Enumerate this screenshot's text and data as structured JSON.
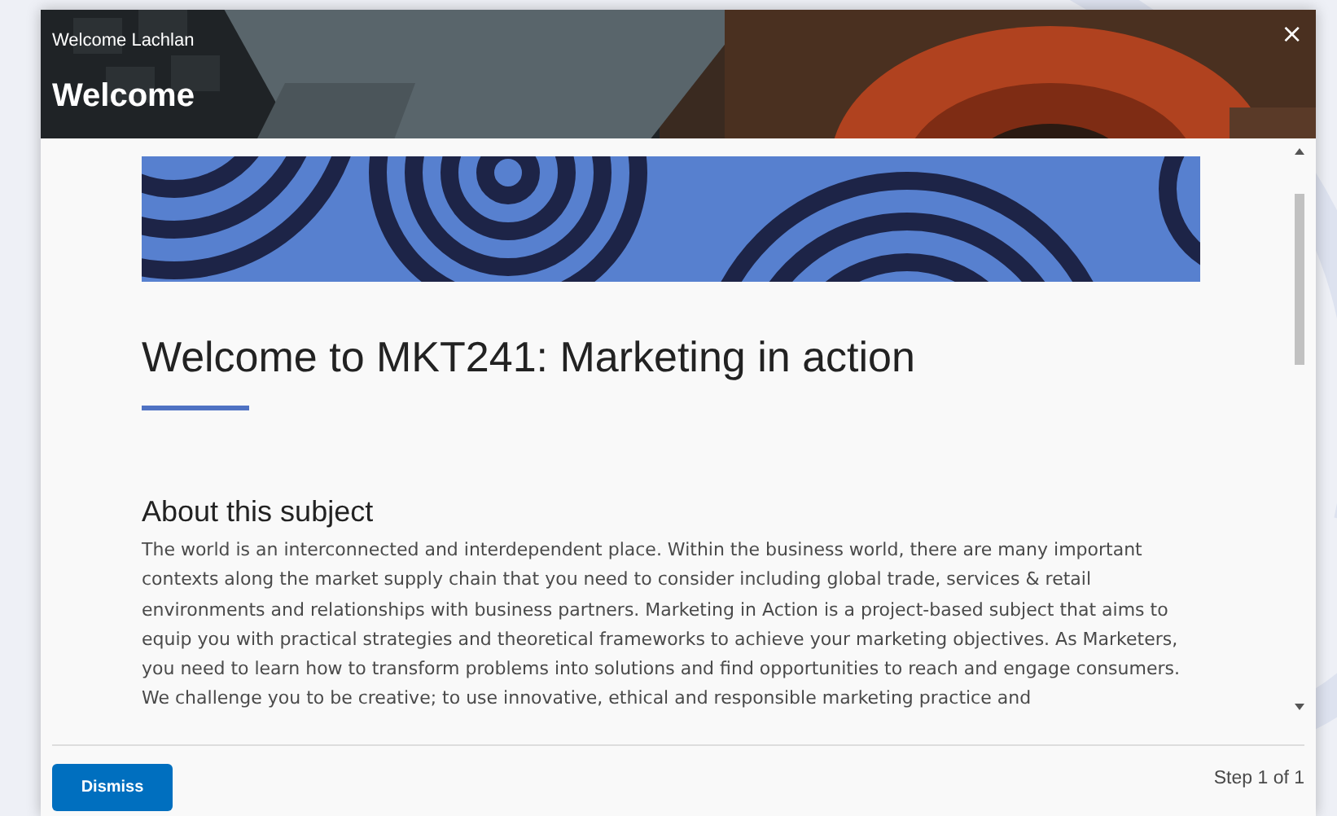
{
  "dialog": {
    "subtitle": "Welcome Lachlan",
    "title": "Welcome",
    "close": "×"
  },
  "content": {
    "heading": "Welcome to MKT241: Marketing in action",
    "section_heading": "About this subject",
    "paragraph": "The world is an interconnected and interdependent place. Within the business world, there are many important contexts along the market supply chain that you need to consider including global trade, services & retail environments and relationships with business partners. Marketing in Action is a project-based subject that aims to equip you with practical strategies and theoretical frameworks to achieve your marketing objectives. As Marketers, you need to learn how to transform problems into solutions and find opportunities to reach and engage consumers. We challenge you to be creative; to use innovative, ethical and responsible marketing practice and"
  },
  "footer": {
    "button": "Dismiss",
    "step": "Step 1 of 1"
  }
}
